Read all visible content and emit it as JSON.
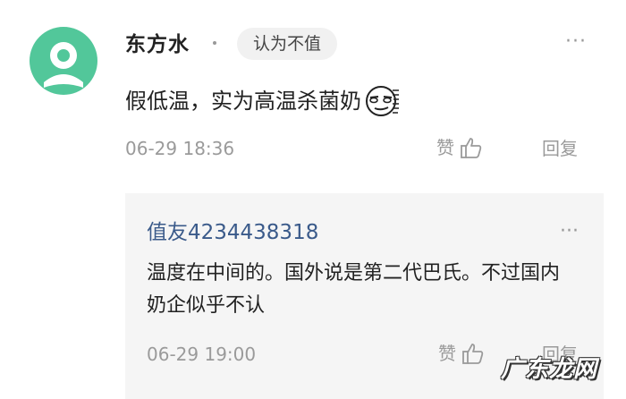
{
  "comment": {
    "username": "东方水",
    "tag": "认为不值",
    "more_icon": "more-icon",
    "text": "假低温，实为高温杀菌奶",
    "emoji": "smirk-emoji-icon",
    "time": "06-29 18:36",
    "like_label": "赞",
    "reply_label": "回复"
  },
  "reply": {
    "username": "值友4234438318",
    "more_icon": "more-icon",
    "text": "温度在中间的。国外说是第二代巴氏。不过国内奶企似乎不认",
    "time": "06-29 19:00",
    "like_label": "赞",
    "reply_label": "回复"
  },
  "watermark": "广东龙网",
  "colors": {
    "avatar": "#52c79a",
    "username_link": "#3a5a8a",
    "meta_text": "#9a9a9a",
    "reply_bg": "#f5f5f5"
  }
}
